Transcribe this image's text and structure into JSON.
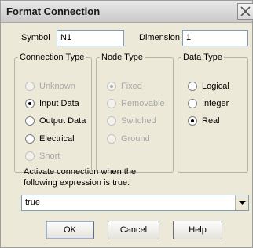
{
  "window": {
    "title": "Format Connection"
  },
  "symbol": {
    "label": "Symbol",
    "value": "N1"
  },
  "dimension": {
    "label": "Dimension",
    "value": "1"
  },
  "connection_type": {
    "label": "Connection Type",
    "options": [
      {
        "label": "Unknown",
        "checked": false,
        "enabled": false
      },
      {
        "label": "Input Data",
        "checked": true,
        "enabled": true
      },
      {
        "label": "Output Data",
        "checked": false,
        "enabled": true
      },
      {
        "label": "Electrical",
        "checked": false,
        "enabled": true
      },
      {
        "label": "Short",
        "checked": false,
        "enabled": false
      }
    ]
  },
  "node_type": {
    "label": "Node Type",
    "options": [
      {
        "label": "Fixed",
        "checked": true,
        "enabled": false
      },
      {
        "label": "Removable",
        "checked": false,
        "enabled": false
      },
      {
        "label": "Switched",
        "checked": false,
        "enabled": false
      },
      {
        "label": "Ground",
        "checked": false,
        "enabled": false
      }
    ]
  },
  "data_type": {
    "label": "Data Type",
    "options": [
      {
        "label": "Logical",
        "checked": false,
        "enabled": true
      },
      {
        "label": "Integer",
        "checked": false,
        "enabled": true
      },
      {
        "label": "Real",
        "checked": true,
        "enabled": true
      }
    ]
  },
  "expression": {
    "label_line1": "Activate connection when the",
    "label_line2": "following expression is true:",
    "value": "true"
  },
  "buttons": {
    "ok": "OK",
    "cancel": "Cancel",
    "help": "Help"
  }
}
